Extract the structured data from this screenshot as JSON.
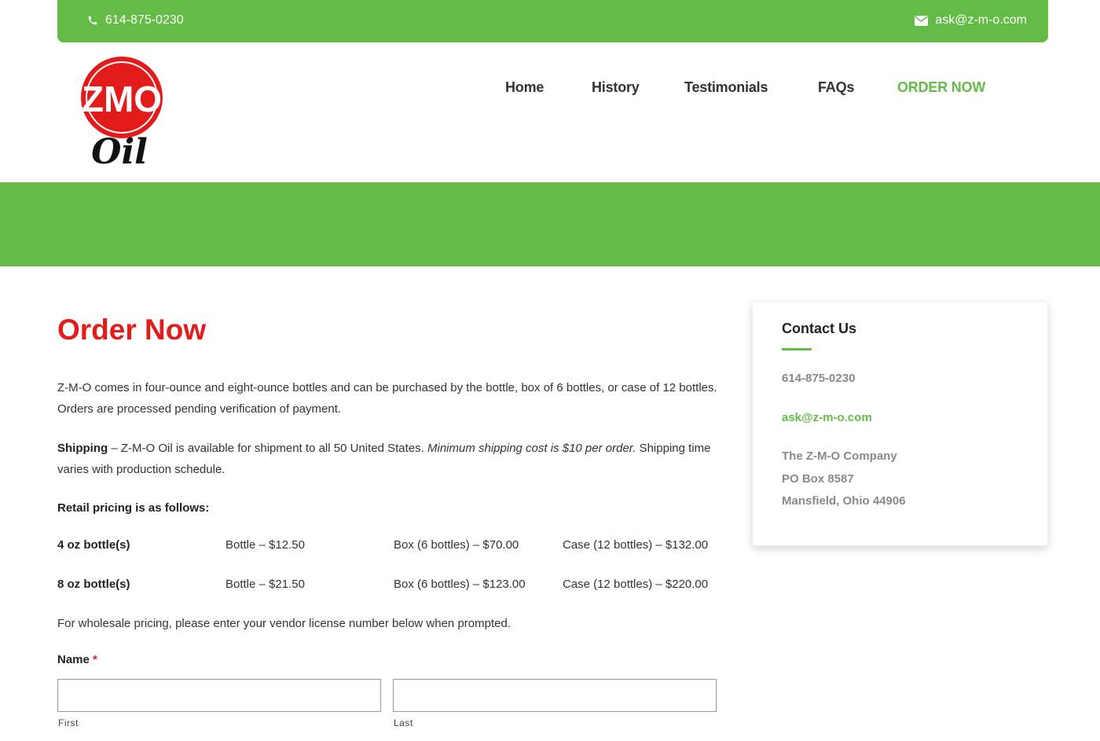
{
  "colors": {
    "brand_green": "#65bb48",
    "title_red": "#e31b1b",
    "text": "#333333",
    "muted": "#8a8a8a"
  },
  "topbar": {
    "phone": "614-875-0230",
    "phone_icon": "phone-icon",
    "email": "ask@z-m-o.com",
    "email_icon": "envelope-icon"
  },
  "logo": {
    "alt": "ZMO Oil logo",
    "wordmark": "ZMO",
    "script": "Oil"
  },
  "nav": [
    {
      "label": "Home",
      "active": false
    },
    {
      "label": "History",
      "active": false
    },
    {
      "label": "Testimonials",
      "active": false
    },
    {
      "label": "FAQs",
      "active": false
    },
    {
      "label": "ORDER NOW",
      "active": true
    }
  ],
  "main": {
    "title": "Order Now",
    "intro": "Z-M-O comes in four-ounce and eight-ounce bottles and can be purchased by the bottle, box of 6 bottles, or case of 12 bottles. Orders are processed pending verification of payment.",
    "shipping_label": "Shipping",
    "shipping_text_1": " – Z-M-O Oil is available for shipment to all 50 United States. ",
    "shipping_italic": "Minimum shipping cost is $10 per order.",
    "shipping_text_2": " Shipping time varies with production schedule.",
    "retail_heading": "Retail pricing is as follows:",
    "pricing": [
      {
        "size": "4 oz bottle(s)",
        "bottle": "Bottle – $12.50",
        "box": "Box (6 bottles) – $70.00",
        "case": "Case (12 bottles) – $132.00"
      },
      {
        "size": "8 oz bottle(s)",
        "bottle": "Bottle – $21.50",
        "box": "Box (6 bottles) – $123.00",
        "case": "Case (12 bottles) – $220.00"
      }
    ],
    "wholesale_note": "For wholesale pricing, please enter your vendor license number below when prompted.",
    "form": {
      "name_label": "Name",
      "required_mark": "*",
      "first_value": "",
      "first_sublabel": "First",
      "last_value": "",
      "last_sublabel": "Last"
    }
  },
  "sidebar": {
    "title": "Contact Us",
    "phone": "614-875-0230",
    "email": "ask@z-m-o.com",
    "company": "The Z-M-O Company",
    "po_box": "PO Box 8587",
    "city": "Mansfield, Ohio 44906"
  }
}
